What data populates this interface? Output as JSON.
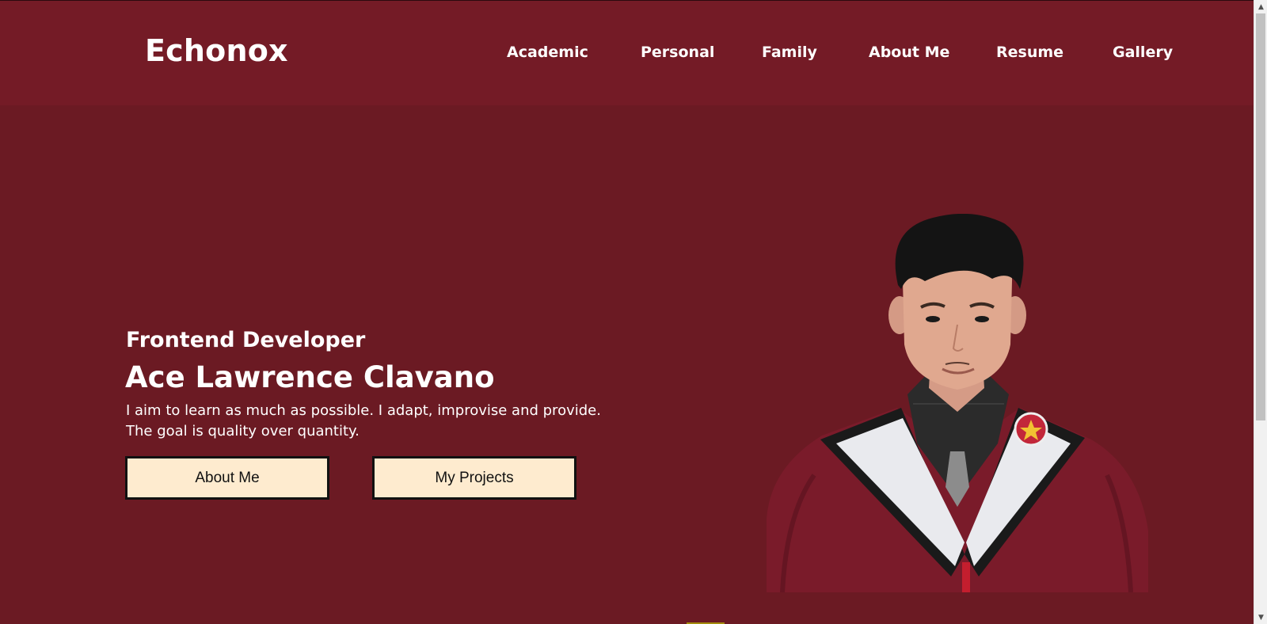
{
  "brand": {
    "name": "Echonox"
  },
  "nav": {
    "items": [
      {
        "label": "Academic"
      },
      {
        "label": "Personal"
      },
      {
        "label": "Family"
      },
      {
        "label": "About Me"
      },
      {
        "label": "Resume"
      },
      {
        "label": "Gallery"
      }
    ]
  },
  "hero": {
    "subtitle": "Frontend Developer",
    "name": "Ace Lawrence Clavano",
    "description_line1": "I aim to learn as much as possible. I adapt, improvise and provide.",
    "description_line2": "The goal is quality over quantity.",
    "buttons": {
      "about": "About Me",
      "projects": "My Projects"
    }
  },
  "colors": {
    "navbar_bg": "#741b26",
    "hero_bg": "#6b1a23",
    "button_bg": "#feebcf",
    "gown": "#7a1b2a",
    "stole": "#e9eaee"
  },
  "icons": {
    "scroll_up": "chevron-up-icon",
    "scroll_down": "chevron-down-icon"
  }
}
